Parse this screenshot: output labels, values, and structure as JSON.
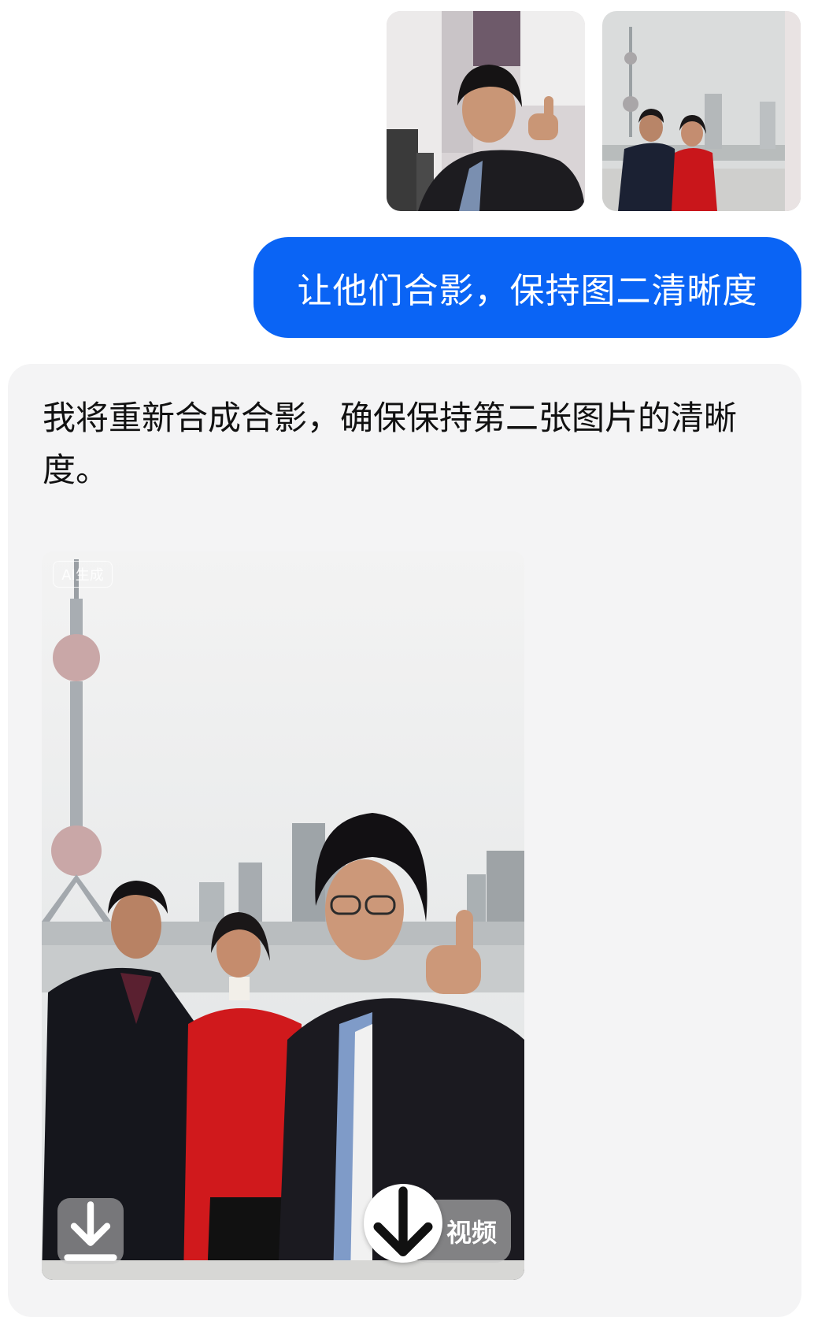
{
  "chat": {
    "user_images": [
      {
        "icon": "photo-thumbnail-man-thumbs-up"
      },
      {
        "icon": "photo-thumbnail-couple-tower"
      }
    ],
    "user_message": "让他们合影，保持图二清晰度",
    "assistant_message": "我将重新合成合影，确保保持第二张图片的清晰度。",
    "generated_image": {
      "watermark": "AI生成",
      "video_label": "视频",
      "download_icon": "download-icon"
    }
  },
  "colors": {
    "user_bubble": "#0a64f5",
    "assistant_card": "#f4f4f5",
    "page_bg": "#ffffff"
  }
}
